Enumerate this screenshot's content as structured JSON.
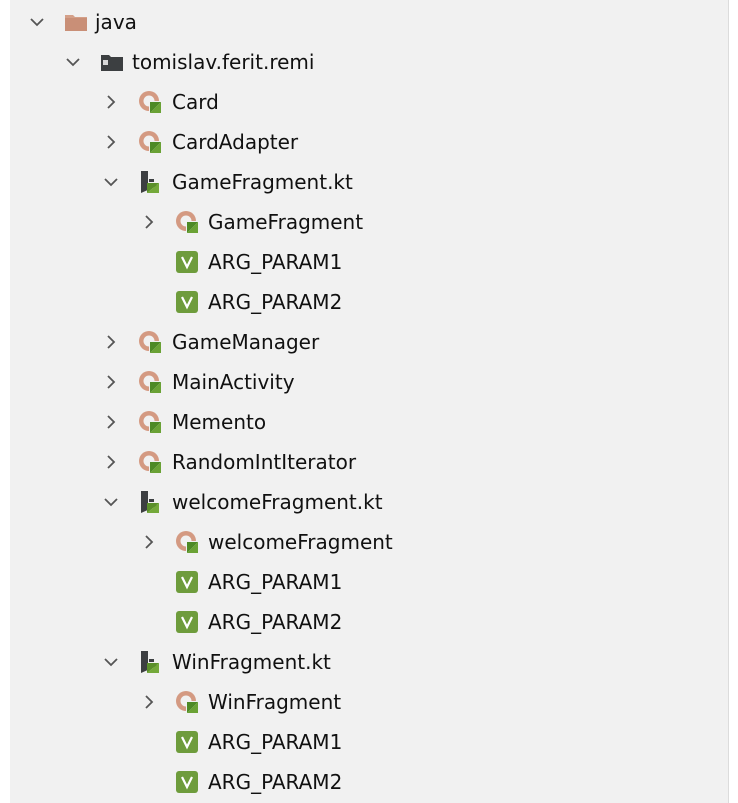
{
  "tree": {
    "root": {
      "label": "java",
      "icon": "folder-icon",
      "expanded": true
    },
    "package": {
      "label": "tomislav.ferit.remi",
      "icon": "package-icon",
      "expanded": true
    },
    "items": [
      {
        "label": "Card",
        "icon": "kotlin-class-icon",
        "expanded": false
      },
      {
        "label": "CardAdapter",
        "icon": "kotlin-class-icon",
        "expanded": false
      },
      {
        "label": "GameFragment.kt",
        "icon": "kotlin-file-icon",
        "expanded": true,
        "children": [
          {
            "label": "GameFragment",
            "icon": "kotlin-class-icon",
            "expanded": false
          },
          {
            "label": "ARG_PARAM1",
            "icon": "val-icon"
          },
          {
            "label": "ARG_PARAM2",
            "icon": "val-icon"
          }
        ]
      },
      {
        "label": "GameManager",
        "icon": "kotlin-class-icon",
        "expanded": false
      },
      {
        "label": "MainActivity",
        "icon": "kotlin-class-icon",
        "expanded": false
      },
      {
        "label": "Memento",
        "icon": "kotlin-class-icon",
        "expanded": false
      },
      {
        "label": "RandomIntIterator",
        "icon": "kotlin-class-icon",
        "expanded": false
      },
      {
        "label": "welcomeFragment.kt",
        "icon": "kotlin-file-icon",
        "expanded": true,
        "children": [
          {
            "label": "welcomeFragment",
            "icon": "kotlin-class-icon",
            "expanded": false
          },
          {
            "label": "ARG_PARAM1",
            "icon": "val-icon"
          },
          {
            "label": "ARG_PARAM2",
            "icon": "val-icon"
          }
        ]
      },
      {
        "label": "WinFragment.kt",
        "icon": "kotlin-file-icon",
        "expanded": true,
        "children": [
          {
            "label": "WinFragment",
            "icon": "kotlin-class-icon",
            "expanded": false
          },
          {
            "label": "ARG_PARAM1",
            "icon": "val-icon"
          },
          {
            "label": "ARG_PARAM2",
            "icon": "val-icon"
          }
        ]
      }
    ]
  },
  "colors": {
    "panel_bg": "#f1f1f1",
    "folder": "#d4a089",
    "package": "#3c3f41",
    "class_circle": "#d49a82",
    "kotlin_green": "#5a8f29",
    "val_green": "#6e9c3c"
  }
}
